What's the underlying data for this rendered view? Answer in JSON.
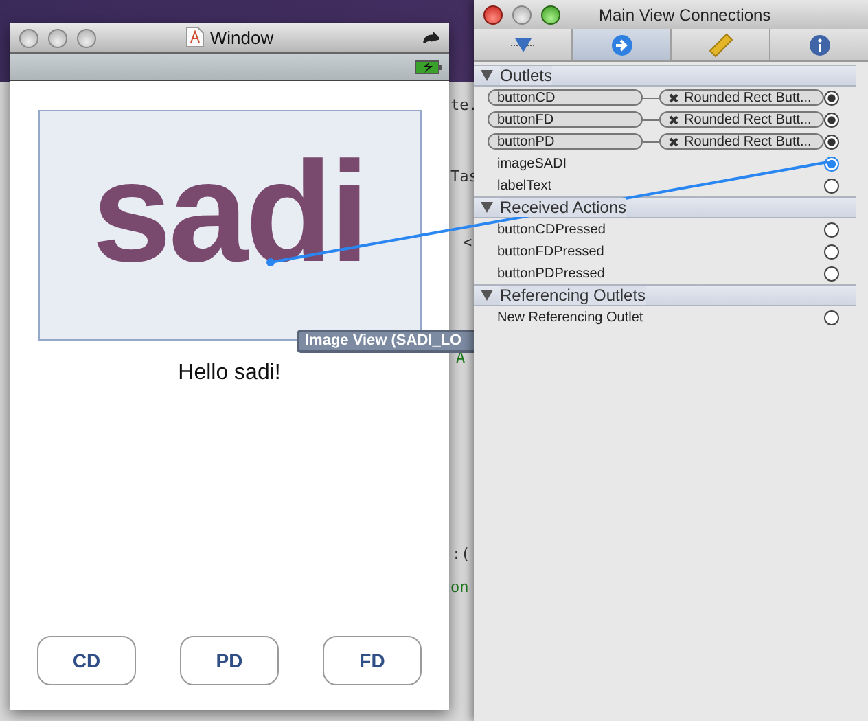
{
  "background": {
    "fragments": [
      {
        "kind": "right",
        "text": "te."
      },
      {
        "kind": "right",
        "text": "Tas"
      },
      {
        "kind": "right",
        "text": "<"
      },
      {
        "kind": "code",
        "text": "A"
      },
      {
        "kind": "right",
        "text": ":("
      },
      {
        "kind": "code",
        "text": "on"
      }
    ]
  },
  "window": {
    "title": "Window"
  },
  "image_view": {
    "logo_text": "sadi"
  },
  "label": "Hello sadi!",
  "buttons": [
    "CD",
    "PD",
    "FD"
  ],
  "tooltip": "Image View (SADI_LO",
  "inspector": {
    "title": "Main View Connections",
    "tabs": [
      {
        "kind": "effects",
        "selected": false
      },
      {
        "kind": "connections",
        "selected": true
      },
      {
        "kind": "size",
        "selected": false
      },
      {
        "kind": "info",
        "selected": false
      }
    ],
    "sections": [
      {
        "title": "Outlets",
        "expanded": true,
        "items": [
          {
            "name": "buttonCD",
            "target": "Rounded Rect Butt...",
            "connected": true,
            "active": false
          },
          {
            "name": "buttonFD",
            "target": "Rounded Rect Butt...",
            "connected": true,
            "active": false
          },
          {
            "name": "buttonPD",
            "target": "Rounded Rect Butt...",
            "connected": true,
            "active": false
          },
          {
            "name": "imageSADI",
            "connected": false,
            "active": true
          },
          {
            "name": "labelText",
            "connected": false,
            "active": false
          }
        ]
      },
      {
        "title": "Received Actions",
        "expanded": true,
        "items": [
          {
            "name": "buttonCDPressed",
            "connected": false,
            "active": false
          },
          {
            "name": "buttonFDPressed",
            "connected": false,
            "active": false
          },
          {
            "name": "buttonPDPressed",
            "connected": false,
            "active": false
          }
        ]
      },
      {
        "title": "Referencing Outlets",
        "expanded": true,
        "items": [
          {
            "name": "New Referencing Outlet",
            "connected": false,
            "active": false
          }
        ]
      }
    ]
  }
}
